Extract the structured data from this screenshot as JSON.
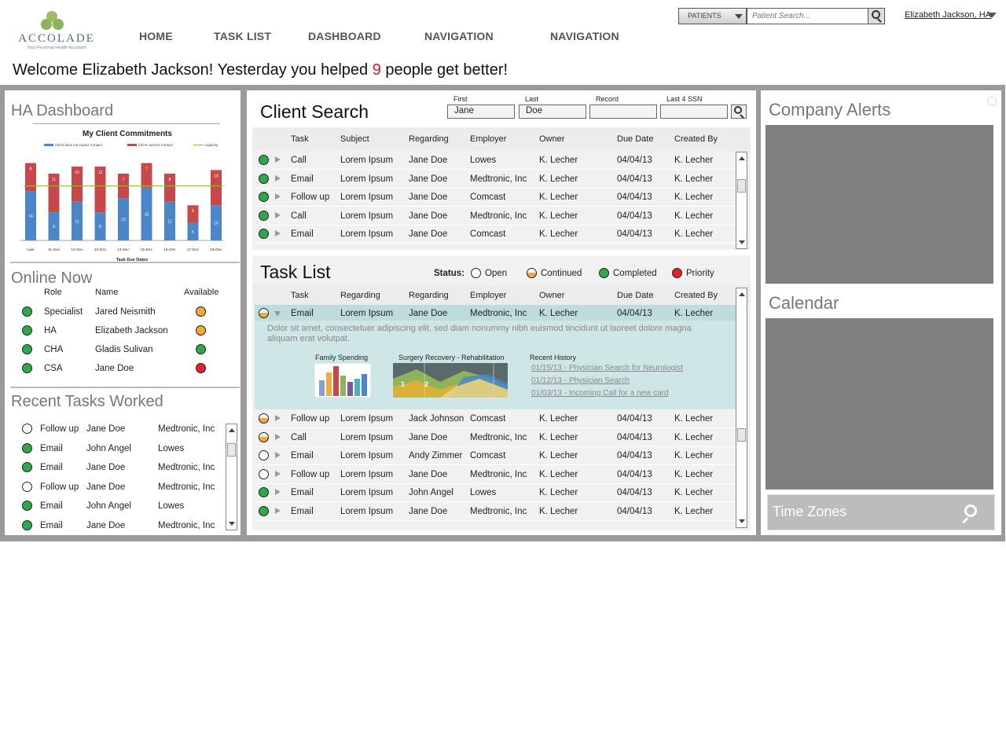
{
  "app": {
    "brand": "ACCOLADE",
    "tagline": "Your Personal Health Assistant"
  },
  "nav": [
    "HOME",
    "TASK LIST",
    "DASHBOARD",
    "NAVIGATION",
    "NAVIGATION"
  ],
  "topbar": {
    "patients_label": "PATIENTS",
    "search_placeholder": "Patient Search...",
    "user": "Elizabeth Jackson, HA"
  },
  "welcome": {
    "before": "Welcome Elizabeth Jackson! Yesterday you helped",
    "count": "9",
    "after": "people get better!"
  },
  "dashboard": {
    "title": "HA Dashboard"
  },
  "chart_data": {
    "type": "bar",
    "title": "My Client Commitments",
    "xlabel": "Task Due Dates",
    "ylabel": "",
    "categories": [
      "Late",
      "11-Dec",
      "12-Dec",
      "13-Dec",
      "14-Dec",
      "15-Dec",
      "16-Dec",
      "17-Dec",
      "18-Dec"
    ],
    "series": [
      {
        "name": "Client does not expect Contact",
        "color": "#4a86c8",
        "values": [
          14,
          8,
          11,
          8,
          12,
          15,
          11,
          5,
          10
        ]
      },
      {
        "name": "Client expects Contact",
        "color": "#c8474a",
        "values": [
          8,
          11,
          10,
          13,
          7,
          7,
          8,
          5,
          10
        ]
      },
      {
        "name": "Capacity",
        "color": "#9cb83c",
        "values": [
          15.5,
          15.5,
          15.5,
          15.5,
          15.5,
          15.5,
          15.5,
          15.5,
          15.5
        ]
      }
    ],
    "stacked": true,
    "ylim": [
      0,
      23
    ],
    "grid": false,
    "legend": "top"
  },
  "online_now": {
    "title": "Online Now",
    "headers": [
      "Role",
      "Name",
      "Available"
    ],
    "rows": [
      {
        "role": "Specialist",
        "name": "Jared Neismith",
        "status": "orange"
      },
      {
        "role": "HA",
        "name": "Elizabeth Jackson",
        "status": "orange"
      },
      {
        "role": "CHA",
        "name": "Gladis Sulivan",
        "status": "green"
      },
      {
        "role": "CSA",
        "name": "Jane Doe",
        "status": "red"
      }
    ]
  },
  "recent_tasks": {
    "title": "Recent Tasks Worked",
    "rows": [
      {
        "status": "open",
        "task": "Follow up",
        "name": "Jane Doe",
        "employer": "Medtronic, Inc"
      },
      {
        "status": "green",
        "task": "Email",
        "name": "John Angel",
        "employer": "Lowes"
      },
      {
        "status": "green",
        "task": "Email",
        "name": "Jane Doe",
        "employer": "Medtronic, Inc"
      },
      {
        "status": "open",
        "task": "Follow up",
        "name": "Jane Doe",
        "employer": "Medtronic, Inc"
      },
      {
        "status": "green",
        "task": "Email",
        "name": "John Angel",
        "employer": "Lowes"
      },
      {
        "status": "green",
        "task": "Email",
        "name": "Jane Doe",
        "employer": "Medtronic, Inc"
      }
    ]
  },
  "client_search": {
    "title": "Client Search",
    "fields": [
      {
        "label": "First",
        "value": "Jane"
      },
      {
        "label": "Last",
        "value": "Doe"
      },
      {
        "label": "Record",
        "value": ""
      },
      {
        "label": "Last 4 SSN",
        "value": ""
      }
    ],
    "headers": [
      "Task",
      "Subject",
      "Regarding",
      "Employer",
      "Owner",
      "Due Date",
      "Created By"
    ],
    "rows": [
      {
        "status": "green",
        "task": "Call",
        "subject": "Lorem Ipsum",
        "regarding": "Jane Doe",
        "employer": "Lowes",
        "owner": "K. Lecher",
        "due": "04/04/13",
        "created": "K. Lecher"
      },
      {
        "status": "green",
        "task": "Email",
        "subject": "Lorem Ipsum",
        "regarding": "Jane Doe",
        "employer": "Medtronic, Inc",
        "owner": "K. Lecher",
        "due": "04/04/13",
        "created": "K. Lecher"
      },
      {
        "status": "green",
        "task": "Follow up",
        "subject": "Lorem Ipsum",
        "regarding": "Jane Doe",
        "employer": "Comcast",
        "owner": "K. Lecher",
        "due": "04/04/13",
        "created": "K. Lecher"
      },
      {
        "status": "green",
        "task": "Call",
        "subject": "Lorem Ipsum",
        "regarding": "Jane Doe",
        "employer": "Medtronic, Inc",
        "owner": "K. Lecher",
        "due": "04/04/13",
        "created": "K. Lecher"
      },
      {
        "status": "green",
        "task": "Email",
        "subject": "Lorem Ipsum",
        "regarding": "Jane Doe",
        "employer": "Comcast",
        "owner": "K. Lecher",
        "due": "04/04/13",
        "created": "K. Lecher"
      }
    ]
  },
  "task_list": {
    "title": "Task List",
    "status_label": "Status:",
    "legend": [
      {
        "status": "open",
        "label": "Open"
      },
      {
        "status": "half",
        "label": "Continued"
      },
      {
        "status": "green",
        "label": "Completed"
      },
      {
        "status": "red",
        "label": "Priority"
      }
    ],
    "headers": [
      "Task",
      "Regarding",
      "Regarding",
      "Employer",
      "Owner",
      "Due Date",
      "Created By"
    ],
    "expanded_row": {
      "status": "half",
      "task": "Email",
      "subject": "Lorem Ipsum",
      "regarding": "Jane Doe",
      "employer": "Medtronic, Inc",
      "owner": "K. Lecher",
      "due": "04/04/13",
      "created": "K. Lecher"
    },
    "detail_text": "Dolor sit amet, consectetuer adipiscing elit, sed diam nonummy nibh euismod tincidunt ut laoreet dolore magna aliquam erat volutpat.",
    "detail_charts": [
      "Family Spending",
      "Surgery Recovery - Rehabilitation"
    ],
    "history_title": "Recent History",
    "history": [
      "01/15/13 - Physician Search for Neurologist",
      "01/12/13 - Physician Search",
      "01/03/13 - Incoming Call for a new card"
    ],
    "rows": [
      {
        "status": "half",
        "task": "Follow up",
        "subject": "Lorem Ipsum",
        "regarding": "Jack Johnson",
        "employer": "Comcast",
        "owner": "K. Lecher",
        "due": "04/04/13",
        "created": "K. Lecher"
      },
      {
        "status": "half",
        "task": "Call",
        "subject": "Lorem Ipsum",
        "regarding": "Jane Doe",
        "employer": "Medtronic, Inc",
        "owner": "K. Lecher",
        "due": "04/04/13",
        "created": "K. Lecher"
      },
      {
        "status": "open",
        "task": "Email",
        "subject": "Lorem Ipsum",
        "regarding": "Andy Zimmer",
        "employer": "Comcast",
        "owner": "K. Lecher",
        "due": "04/04/13",
        "created": "K. Lecher"
      },
      {
        "status": "open",
        "task": "Follow up",
        "subject": "Lorem Ipsum",
        "regarding": "Jane Doe",
        "employer": "Medtronic, Inc",
        "owner": "K. Lecher",
        "due": "04/04/13",
        "created": "K. Lecher"
      },
      {
        "status": "green",
        "task": "Email",
        "subject": "Lorem Ipsum",
        "regarding": "John Angel",
        "employer": "Lowes",
        "owner": "K. Lecher",
        "due": "04/04/13",
        "created": "K. Lecher"
      },
      {
        "status": "green",
        "task": "Email",
        "subject": "Lorem Ipsum",
        "regarding": "Jane Doe",
        "employer": "Medtronic, Inc",
        "owner": "K. Lecher",
        "due": "04/04/13",
        "created": "K. Lecher"
      }
    ]
  },
  "right": {
    "alerts_title": "Company Alerts",
    "calendar_title": "Calendar",
    "timezones_label": "Time Zones"
  },
  "colors": {
    "accent_red": "#c0242e",
    "frame": "#9a9a9a",
    "expanded_row": "#cfe6e6"
  }
}
